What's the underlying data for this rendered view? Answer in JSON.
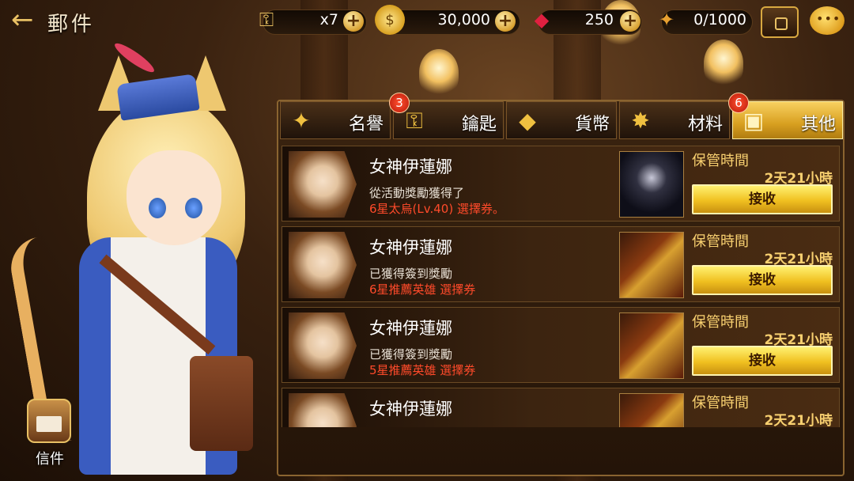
{
  "header": {
    "title": "郵件",
    "back_icon": "back-arrow-icon"
  },
  "resources": [
    {
      "name": "key",
      "icon": "key-icon",
      "value": "x7"
    },
    {
      "name": "gold",
      "icon": "gold-coin-icon",
      "value": "30,000"
    },
    {
      "name": "ruby",
      "icon": "ruby-icon",
      "value": "250"
    },
    {
      "name": "medal",
      "icon": "medal-icon",
      "value": "0/1000"
    }
  ],
  "tabs": [
    {
      "label": "名譽",
      "icon": "honor-icon",
      "badge": null,
      "active": false
    },
    {
      "label": "鑰匙",
      "icon": "key-icon",
      "badge": "3",
      "active": false
    },
    {
      "label": "貨幣",
      "icon": "currency-icon",
      "badge": null,
      "active": false
    },
    {
      "label": "材料",
      "icon": "material-icon",
      "badge": null,
      "active": false
    },
    {
      "label": "其他",
      "icon": "other-chest-icon",
      "badge": "6",
      "active": true
    }
  ],
  "mails": [
    {
      "sender": "女神伊蓮娜",
      "desc": "從活動獎勵獲得了",
      "reward": "6星太烏(Lv.40) 選擇券。",
      "thumb": "hero",
      "storage_label": "保管時間",
      "storage_time": "2天21小時",
      "claim_label": "接收"
    },
    {
      "sender": "女神伊蓮娜",
      "desc": "已獲得簽到獎勵",
      "reward": "6星推薦英雄 選擇券",
      "thumb": "card",
      "storage_label": "保管時間",
      "storage_time": "2天21小時",
      "claim_label": "接收"
    },
    {
      "sender": "女神伊蓮娜",
      "desc": "已獲得簽到獎勵",
      "reward": "5星推薦英雄 選擇券",
      "thumb": "card",
      "storage_label": "保管時間",
      "storage_time": "2天21小時",
      "claim_label": "接收"
    },
    {
      "sender": "女神伊蓮娜",
      "desc": "",
      "reward": "",
      "thumb": "card",
      "storage_label": "保管時間",
      "storage_time": "2天21小時",
      "claim_label": ""
    }
  ],
  "mailbox": {
    "label": "信件"
  },
  "colors": {
    "accent_gold": "#f0c020",
    "reward_red": "#ff4a2a",
    "panel_bg": "#2a1a0c"
  }
}
